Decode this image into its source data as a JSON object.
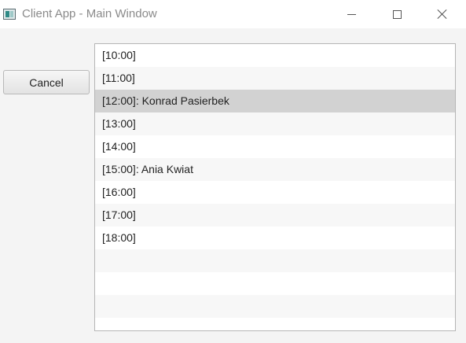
{
  "window": {
    "title": "Client App - Main Window",
    "icon": "app-window-icon",
    "controls": [
      "minimize-icon",
      "maximize-icon",
      "close-icon"
    ]
  },
  "actions": {
    "cancel_label": "Cancel"
  },
  "schedule": {
    "selected_index": 2,
    "items": [
      {
        "label": "[10:00]"
      },
      {
        "label": "[11:00]"
      },
      {
        "label": "[12:00]: Konrad Pasierbek"
      },
      {
        "label": "[13:00]"
      },
      {
        "label": "[14:00]"
      },
      {
        "label": "[15:00]: Ania Kwiat"
      },
      {
        "label": "[16:00]"
      },
      {
        "label": "[17:00]"
      },
      {
        "label": "[18:00]"
      },
      {
        "label": ""
      },
      {
        "label": ""
      },
      {
        "label": ""
      },
      {
        "label": ""
      }
    ]
  }
}
